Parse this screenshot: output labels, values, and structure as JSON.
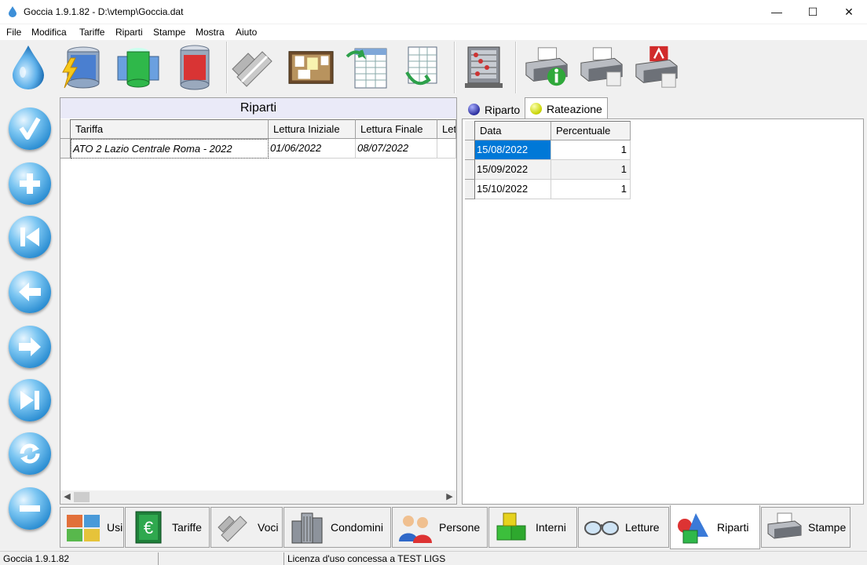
{
  "window": {
    "title": "Goccia 1.9.1.82 - D:\\vtemp\\Goccia.dat"
  },
  "menu": [
    "File",
    "Modifica",
    "Tariffe",
    "Riparti",
    "Stampe",
    "Mostra",
    "Aiuto"
  ],
  "toolbar_icons": [
    "water-drop-icon",
    "energy-database-icon",
    "multi-database-icon",
    "red-database-icon",
    "pipes-icon",
    "bulletin-board-icon",
    "spreadsheet-import-icon",
    "spreadsheet-export-icon",
    "abacus-icon",
    "printer-info-icon",
    "printer-icon",
    "printer-pdf-icon"
  ],
  "nav_icons": [
    "confirm-icon",
    "add-icon",
    "first-record-icon",
    "previous-record-icon",
    "next-record-icon",
    "last-record-icon",
    "refresh-icon",
    "remove-icon"
  ],
  "riparti": {
    "caption": "Riparti",
    "columns": [
      "Tariffa",
      "Lettura Iniziale",
      "Lettura Finale",
      "Let"
    ],
    "rows": [
      [
        "ATO 2 Lazio Centrale Roma - 2022",
        "01/06/2022",
        "08/07/2022",
        ""
      ]
    ]
  },
  "right_tabs": {
    "riparto": "Riparto",
    "rateazione": "Rateazione"
  },
  "rateazione": {
    "columns": [
      "Data",
      "Percentuale"
    ],
    "rows": [
      [
        "15/08/2022",
        "1"
      ],
      [
        "15/09/2022",
        "1"
      ],
      [
        "15/10/2022",
        "1"
      ]
    ]
  },
  "bottom_tabs": [
    "Usi",
    "Tariffe",
    "Voci",
    "Condomini",
    "Persone",
    "Interni",
    "Letture",
    "Riparti",
    "Stampe"
  ],
  "status": {
    "version": "Goccia 1.9.1.82",
    "middle": "",
    "license": "Licenza d'uso concessa a TEST LIGS"
  },
  "colors": {
    "selection": "#0078d7",
    "caption_bg": "#eaeaf8",
    "riparto_ball": "#2b2e9e",
    "rateazione_ball": "#c8d400"
  }
}
